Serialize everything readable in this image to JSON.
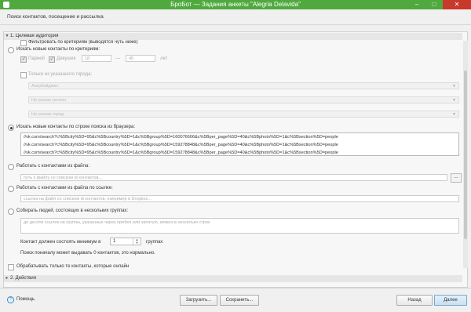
{
  "window": {
    "title": "БроБот — Задания анкеты \"Alegria Delavida\""
  },
  "subtitle": "Поиск контактов, посещение и рассылка",
  "section1": {
    "header": "1. Целевая аудитория",
    "filter_label": "Фильтровать по критериям (выводятся чуть ниже)",
    "search_new": {
      "label": "Искать новые контакты по критериям:",
      "male": "Парней",
      "female": "Девушек",
      "age_from": "18",
      "dash": "—",
      "age_to": "45",
      "years": "лет",
      "city_only": "Только из указанного города:",
      "country_placeholder": "Азербайджан",
      "region_placeholder": "Не указан регион",
      "city_placeholder": "Не указан город"
    },
    "search_browser": {
      "label": "Искать новые контакты по строке поиска из браузера:",
      "lines": [
        "//vk.com/search?c%5Bcity%5D=95&c%5Bcountry%5D=1&c%5Bgroup%5D=160076606&c%5Bper_page%5D=40&c%5Bphoto%5D=1&c%5Bsection%5D=people",
        "//vk.com/search?c%5Bcity%5D=95&c%5Bcountry%5D=1&c%5Bgroup%5D=159278848&c%5Bper_page%5D=40&c%5Bphoto%5D=1&c%5Bsection%5D=people",
        "//vk.com/search?c%5Bcity%5D=95&c%5Bcountry%5D=1&c%5Bgroup%5D=159278848&c%5Bper_page%5D=40&c%5Bphoto%5D=1&c%5Bsection%5D=people"
      ]
    },
    "from_file": {
      "label": "Работать с контактами из файла:",
      "placeholder": "путь к файлу со списком id контактов...",
      "browse": "..."
    },
    "from_link": {
      "label": "Работать с контактами из файла по ссылке:",
      "placeholder": "ссылка на файл со списком id контактов, например в Dropbox..."
    },
    "groups": {
      "label": "Собирать людей, состоящих в нескольких группах:",
      "placeholder": "до десяти ссылок на группы, указанных через пробел или запятую, можно в несколько строк",
      "min_label": "Контакт должен состоять минимум в",
      "min_value": "1",
      "groups_word": "группах",
      "note": "Поиск поначалу может выдавать 0 контактов, это нормально."
    },
    "online_only": "Обрабатывать только те контакты, которые онлайн"
  },
  "section2": {
    "header": "2. Действия"
  },
  "footer": {
    "help": "Помощь",
    "load": "Загрузить...",
    "save": "Сохранить...",
    "back": "Назад",
    "next": "Далее"
  }
}
